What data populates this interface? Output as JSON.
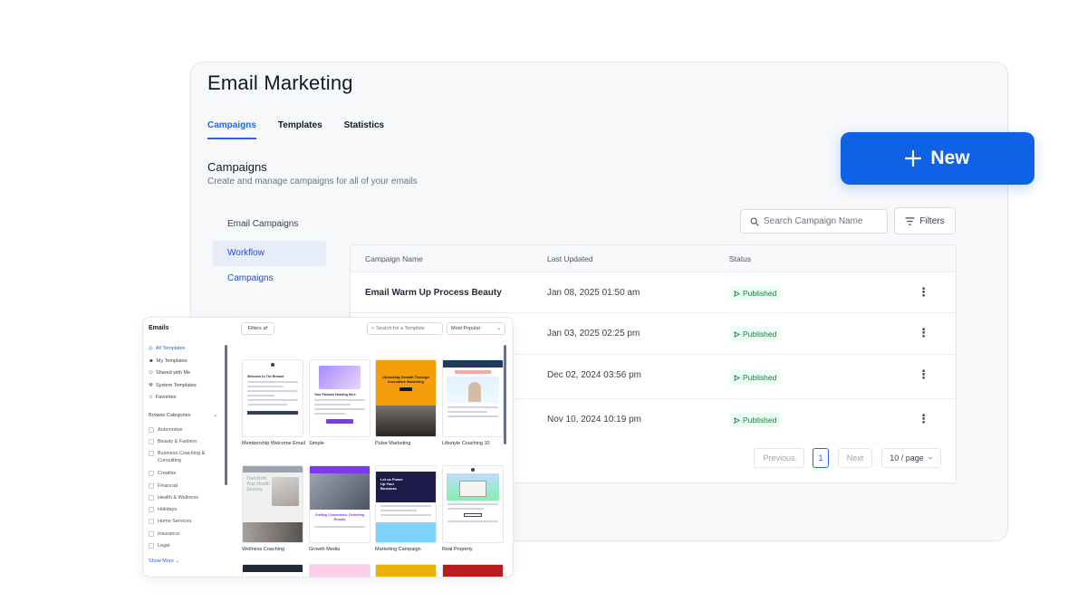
{
  "app": {
    "title": "Email Marketing"
  },
  "tabs": [
    {
      "label": "Campaigns",
      "active": true
    },
    {
      "label": "Templates",
      "active": false
    },
    {
      "label": "Statistics",
      "active": false
    }
  ],
  "section": {
    "title": "Campaigns",
    "subtitle": "Create and manage campaigns for all of your emails"
  },
  "sidebar": {
    "items": [
      {
        "label": "Email Campaigns",
        "active": false
      },
      {
        "label": "Workflow Campaigns",
        "active": true
      }
    ]
  },
  "search": {
    "placeholder": "Search Campaign Name"
  },
  "filters": {
    "label": "Filters"
  },
  "new_button": {
    "label": "New"
  },
  "table": {
    "columns": [
      "Campaign Name",
      "Last Updated",
      "Status"
    ],
    "rows": [
      {
        "name": "Email Warm Up Process Beauty",
        "updated": "Jan 08, 2025 01:50 am",
        "status": "Published"
      },
      {
        "name": "",
        "updated": "Jan 03, 2025 02:25 pm",
        "status": "Published"
      },
      {
        "name": "",
        "updated": "Dec 02, 2024 03:56 pm",
        "status": "Published"
      },
      {
        "name": "",
        "updated": "Nov 10, 2024 10:19 pm",
        "status": "Published"
      }
    ]
  },
  "pagination": {
    "previous": "Previous",
    "current": "1",
    "next": "Next",
    "page_size": "10 / page"
  },
  "template_picker": {
    "title": "Emails",
    "filters_label": "Filters",
    "search_placeholder": "Search for a Template",
    "sort_value": "Most Popular",
    "nav": [
      {
        "label": "All Templates",
        "icon": "grid-icon",
        "active": true
      },
      {
        "label": "My Templates",
        "icon": "user-icon",
        "active": false
      },
      {
        "label": "Shared with Me",
        "icon": "users-icon",
        "active": false
      },
      {
        "label": "System Templates",
        "icon": "wrench-icon",
        "active": false
      },
      {
        "label": "Favorites",
        "icon": "star-icon",
        "active": false
      }
    ],
    "categories_heading": "Browse Categories",
    "categories": [
      "Automotive",
      "Beauty & Fashion",
      "Business Coaching & Consulting",
      "Creative",
      "Financial",
      "Health & Wellness",
      "Holidays",
      "Home Services",
      "Insurance",
      "Legal"
    ],
    "show_more": "Show More",
    "templates": [
      {
        "name": "Membership Welcome Email",
        "heading": "Welcome to The Reward"
      },
      {
        "name": "Simple",
        "heading": "Your Fashion Heading Here"
      },
      {
        "name": "Pulse Marketing",
        "heading": "Unlocking Growth Through Innovative Marketing"
      },
      {
        "name": "Lifestyle Coaching 10",
        "heading": ""
      },
      {
        "name": "Wellness Coaching",
        "heading": "Transform Your Health Journey"
      },
      {
        "name": "Growth Media",
        "heading": "Crafting Connections, Delivering Results"
      },
      {
        "name": "Marketing Campaign",
        "heading": "Let us Power Up Your Business"
      },
      {
        "name": "Real Property",
        "heading": ""
      }
    ]
  },
  "colors": {
    "accent": "#2563eb",
    "new_button": "#0f62e6",
    "published_bg": "#ecfdf3",
    "published_text": "#15803d"
  }
}
